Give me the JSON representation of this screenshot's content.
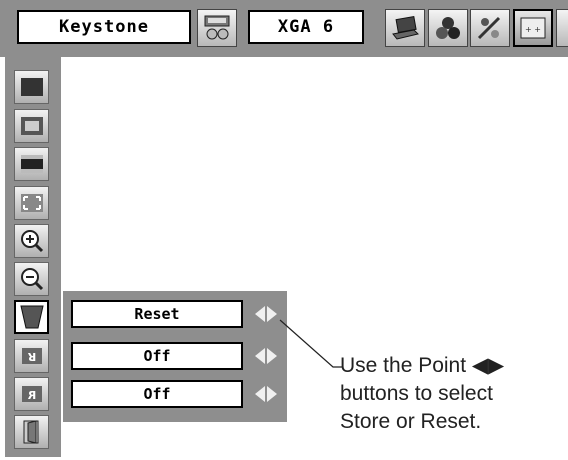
{
  "menu": {
    "title": "Keystone",
    "input_mode": "XGA 6",
    "toolbar_icons": [
      "pc-adjust-icon",
      "laptop-icon",
      "color-icon",
      "image-adjust-icon",
      "screen-icon"
    ],
    "active_toolbar_icon": "screen-icon"
  },
  "sidebar": {
    "items": [
      {
        "icon": "normal-screen-icon"
      },
      {
        "icon": "true-screen-icon"
      },
      {
        "icon": "wide-screen-icon"
      },
      {
        "icon": "custom-screen-icon"
      },
      {
        "icon": "zoom-in-icon"
      },
      {
        "icon": "zoom-out-icon"
      },
      {
        "icon": "keystone-icon",
        "active": true
      },
      {
        "icon": "ceiling-icon"
      },
      {
        "icon": "rear-icon"
      },
      {
        "icon": "exit-icon"
      }
    ]
  },
  "submenu": {
    "rows": [
      {
        "value": "Reset"
      },
      {
        "value": "Off"
      },
      {
        "value": "Off"
      }
    ]
  },
  "callout": {
    "line1": "Use the Point ◀▶",
    "line2": "buttons to select",
    "line3": "Store or Reset."
  }
}
